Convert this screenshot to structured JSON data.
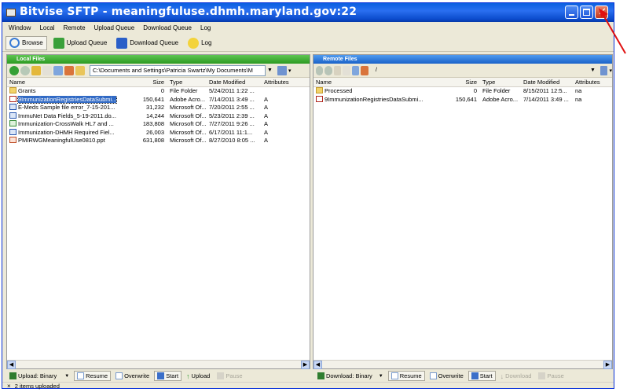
{
  "window": {
    "title": "Bitvise SFTP - meaningfuluse.dhmh.maryland.gov:22"
  },
  "menu": [
    "Window",
    "Local",
    "Remote",
    "Upload Queue",
    "Download Queue",
    "Log"
  ],
  "toolbar": {
    "browse": "Browse",
    "upload_queue": "Upload Queue",
    "download_queue": "Download Queue",
    "log": "Log"
  },
  "local": {
    "header": "Local Files",
    "path": "C:\\Documents and Settings\\Patricia Swartz\\My Documents\\M",
    "columns": [
      "Name",
      "Size",
      "Type",
      "Date Modified",
      "Attributes"
    ],
    "rows": [
      {
        "name": "Grants",
        "size": "0",
        "type": "File Folder",
        "date": "5/24/2011 1:22 ...",
        "attr": "",
        "icon": "folder-icon"
      },
      {
        "name": "9ImmunizationRegistriesDataSubmi...",
        "size": "150,641",
        "type": "Adobe Acro...",
        "date": "7/14/2011 3:49 ...",
        "attr": "A",
        "icon": "pdf-icon"
      },
      {
        "name": "E-Meds Sample file error_7-15-201...",
        "size": "31,232",
        "type": "Microsoft Of...",
        "date": "7/20/2011 2:55 ...",
        "attr": "A",
        "icon": "doc-icon"
      },
      {
        "name": "ImmuNet Data Fields_5-19-2011.do...",
        "size": "14,244",
        "type": "Microsoft Of...",
        "date": "5/23/2011 2:39 ...",
        "attr": "A",
        "icon": "doc-icon"
      },
      {
        "name": "Immunization-CrossWalk HL7 and ...",
        "size": "183,808",
        "type": "Microsoft Of...",
        "date": "7/27/2011 9:26 ...",
        "attr": "A",
        "icon": "xls-icon"
      },
      {
        "name": "Immunization-DHMH Required Fiel...",
        "size": "26,003",
        "type": "Microsoft Of...",
        "date": "6/17/2011 11:1...",
        "attr": "A",
        "icon": "doc-icon"
      },
      {
        "name": "PMIRWGMeaningfulUse0810.ppt",
        "size": "631,808",
        "type": "Microsoft Of...",
        "date": "8/27/2010 8:05 ...",
        "attr": "A",
        "icon": "ppt-icon"
      }
    ]
  },
  "remote": {
    "header": "Remote Files",
    "path": "/",
    "columns": [
      "Name",
      "Size",
      "Type",
      "Date Modified",
      "Attributes"
    ],
    "rows": [
      {
        "name": "Processed",
        "size": "0",
        "type": "File Folder",
        "date": "8/15/2011 12:5...",
        "attr": "na",
        "icon": "folder-icon"
      },
      {
        "name": "9ImmunizationRegistriesDataSubmi...",
        "size": "150,641",
        "type": "Adobe Acro...",
        "date": "7/14/2011 3:49 ...",
        "attr": "na",
        "icon": "pdf-icon"
      }
    ]
  },
  "upload_bar": {
    "mode": "Upload: Binary",
    "resume": "Resume",
    "overwrite": "Overwrite",
    "start": "Start",
    "upload": "Upload",
    "pause": "Pause"
  },
  "download_bar": {
    "mode": "Download: Binary",
    "resume": "Resume",
    "overwrite": "Overwrite",
    "start": "Start",
    "download": "Download",
    "pause": "Pause"
  },
  "status": {
    "text": "2 items uploaded"
  },
  "colors": {
    "title_blue": "#0a5fe0",
    "local_green": "#2c9a22",
    "remote_blue": "#1a62c8",
    "annotation_red": "#e01010"
  }
}
